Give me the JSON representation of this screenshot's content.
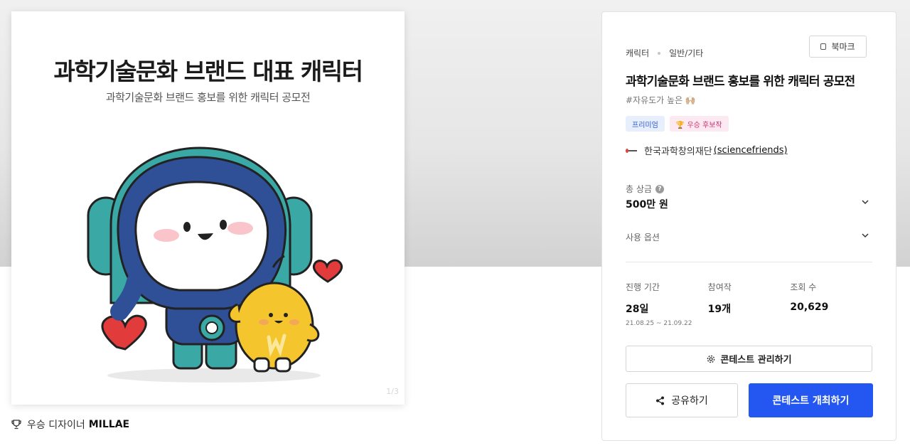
{
  "hero": {
    "title": "과학기술문화 브랜드 대표 캐릭터",
    "subtitle": "과학기술문화 브랜드 홍보를 위한 캐릭터 공모전",
    "page_marker": "1/3"
  },
  "winner": {
    "prefix": "우승 디자이너",
    "name": "MILLAE"
  },
  "panel": {
    "category": "캐릭터",
    "subcategory": "일반/기타",
    "bookmark_label": "북마크",
    "title": "과학기술문화 브랜드 홍보를 위한 캐릭터 공모전",
    "hashtag": "#자유도가 높은 🙌🏼",
    "badges": {
      "premium": "프리미엄",
      "candidate": "🏆 우승 후보작"
    },
    "organizer": {
      "name": "한국과학창의재단",
      "handle": "(sciencefriends)"
    },
    "prize": {
      "label": "총 상금",
      "value": "500만 원"
    },
    "usage": {
      "label": "사용 옵션"
    },
    "stats": {
      "period_label": "진행 기간",
      "period_value": "28일",
      "period_range": "21.08.25 ~ 21.09.22",
      "entries_label": "참여작",
      "entries_value": "19개",
      "views_label": "조회 수",
      "views_value": "20,629"
    },
    "buttons": {
      "manage": "콘테스트 관리하기",
      "share": "공유하기",
      "host": "콘테스트 개최하기"
    }
  },
  "colors": {
    "primary": "#2457f2",
    "premium_badge_bg": "#e7eefc",
    "candidate_badge_bg": "#fde9f1",
    "character_teal": "#3aa8a4",
    "character_navy": "#2f4f97",
    "character_yellow": "#f5c52d",
    "heart_red": "#e23b3b"
  }
}
